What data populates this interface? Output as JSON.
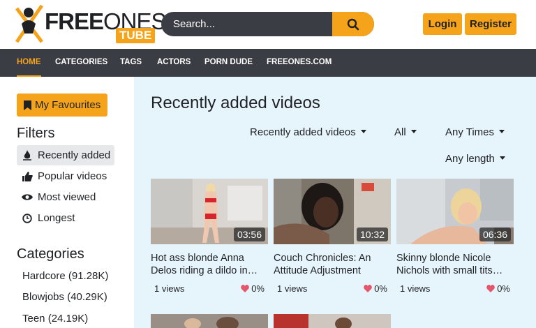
{
  "header": {
    "logo_word1": "FREE",
    "logo_word2": "ONES",
    "logo_tube": "TUBE",
    "search_placeholder": "Search...",
    "login_label": "Login",
    "register_label": "Register"
  },
  "nav": {
    "items": [
      "HOME",
      "CATEGORIES",
      "TAGS",
      "ACTORS",
      "PORN DUDE",
      "FREEONES.COM"
    ]
  },
  "sidebar": {
    "fav_label": "My Favourites",
    "filters_heading": "Filters",
    "filters": [
      "Recently added",
      "Popular videos",
      "Most viewed",
      "Longest"
    ],
    "categories_heading": "Categories",
    "categories": [
      "Hardcore (91.28K)",
      "Blowjobs (40.29K)",
      "Teen (24.19K)"
    ]
  },
  "main": {
    "title": "Recently added videos",
    "sort_label": "Recently added videos",
    "quality_label": "All",
    "time_label": "Any Times",
    "length_label": "Any length"
  },
  "videos": [
    {
      "duration": "03:56",
      "title_l1": "Hot ass blonde Anna",
      "title_l2": "Delos riding a dildo in…",
      "views": "1 views",
      "rating": "0%"
    },
    {
      "duration": "10:32",
      "title_l1": "Couch Chronicles: An",
      "title_l2": "Attitude Adjustment",
      "views": "1 views",
      "rating": "0%"
    },
    {
      "duration": "06:36",
      "title_l1": "Skinny blonde Nicole",
      "title_l2": "Nichols with small tits…",
      "views": "1 views",
      "rating": "0%"
    }
  ],
  "colors": {
    "accent": "#f5a31a",
    "dark": "#3a3e44",
    "main_bg": "#e6f4fc",
    "heart": "#e5566d"
  }
}
